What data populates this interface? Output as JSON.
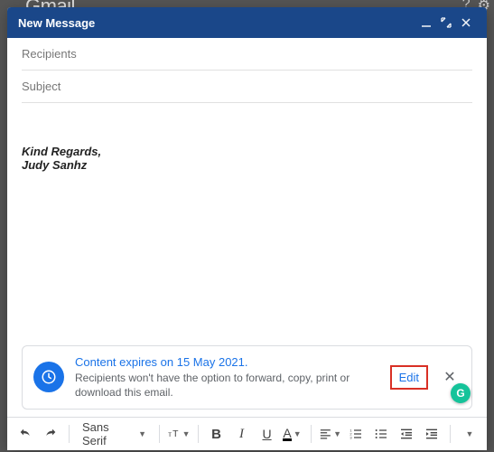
{
  "window": {
    "title": "New Message"
  },
  "fields": {
    "recipients_placeholder": "Recipients",
    "subject_placeholder": "Subject"
  },
  "body": {
    "signature_line1": "Kind Regards,",
    "signature_line2": "Judy Sanhz"
  },
  "confidential": {
    "title": "Content expires on 15 May 2021.",
    "subtitle": "Recipients won't have the option to forward, copy, print or download this email.",
    "edit_label": "Edit"
  },
  "toolbar": {
    "font_family": "Sans Serif"
  }
}
